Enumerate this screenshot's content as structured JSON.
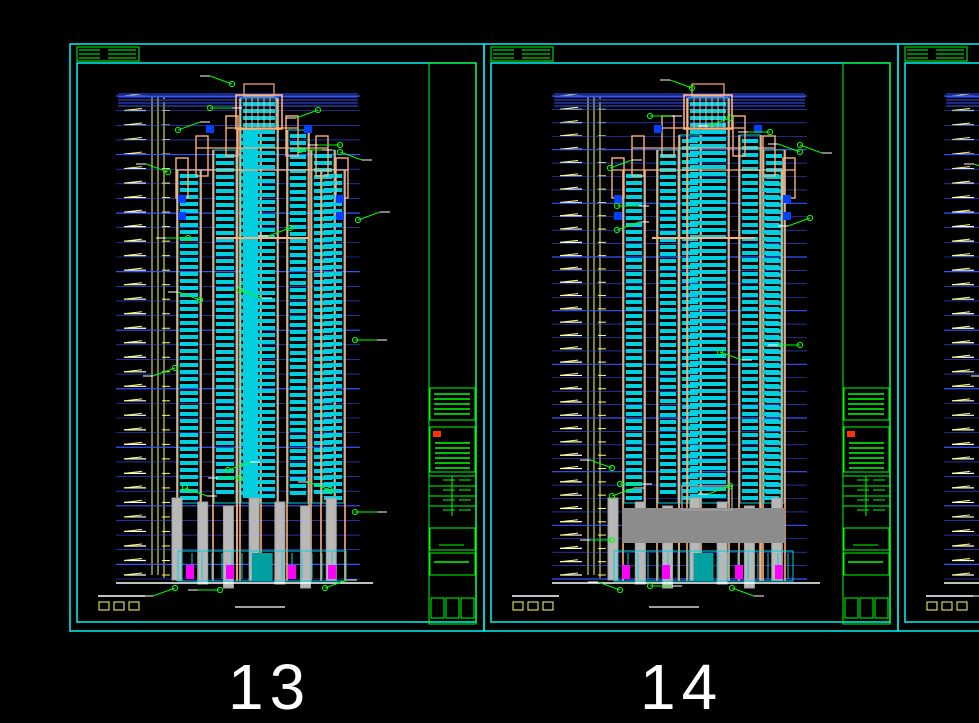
{
  "colors": {
    "background": "#000000",
    "sheet_border": "#00e5e5",
    "title_block": "#00ff00",
    "facade_cyan": "#00cfe0",
    "facade_orange": "#ffb07a",
    "leader_green": "#00ff00",
    "level_yellow": "#ffff66",
    "level_blue": "#3355ff",
    "accent_magenta": "#ff00ff",
    "base_grey": "#a0a0a0",
    "label_white": "#ffffff"
  },
  "sheets": [
    {
      "id": "sheet-1",
      "variant": "a",
      "caption": "13"
    },
    {
      "id": "sheet-2",
      "variant": "b",
      "caption": "14"
    },
    {
      "id": "sheet-3",
      "variant": "a",
      "caption": ""
    }
  ]
}
